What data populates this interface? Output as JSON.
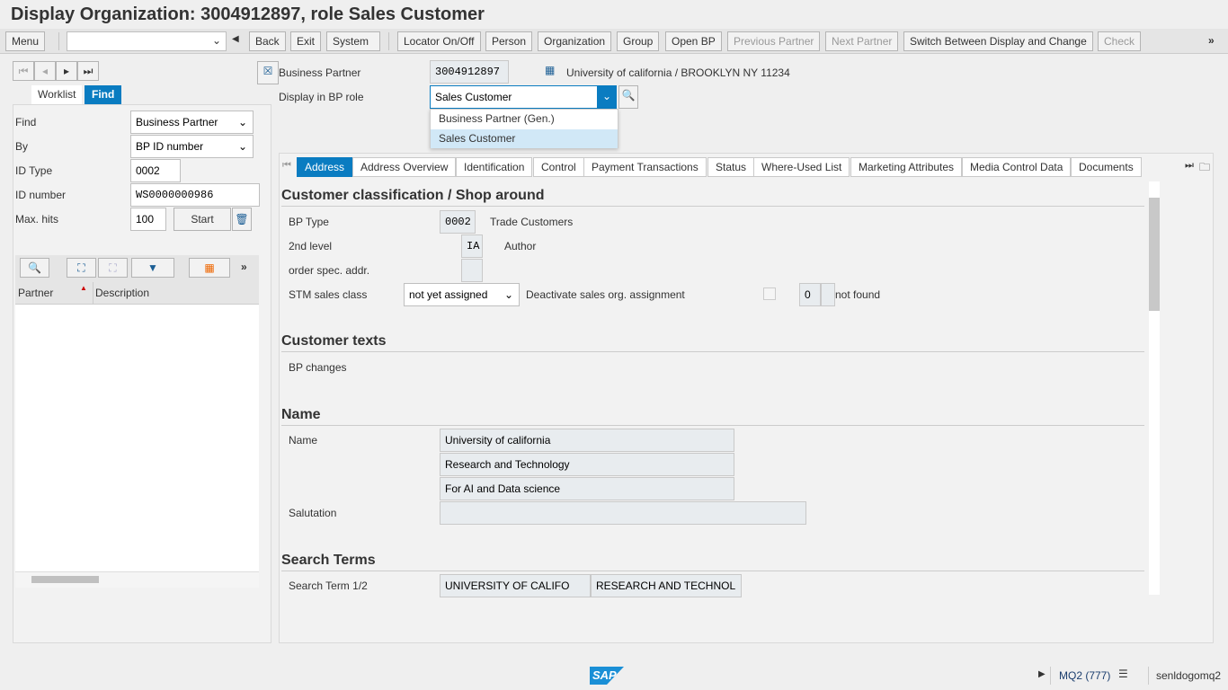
{
  "title": "Display Organization: 3004912897, role Sales Customer",
  "toolbar": {
    "menu": "Menu",
    "back": "Back",
    "exit": "Exit",
    "system": "System",
    "locator": "Locator On/Off",
    "person": "Person",
    "organization": "Organization",
    "group": "Group",
    "open_bp": "Open BP",
    "prev_partner": "Previous Partner",
    "next_partner": "Next Partner",
    "switch": "Switch Between Display and Change",
    "check": "Check",
    "command_value": ""
  },
  "left": {
    "tabs": [
      "Worklist",
      "Find"
    ],
    "active_tab": "Find",
    "find_label": "Find",
    "find_value": "Business Partner",
    "by_label": "By",
    "by_value": "BP ID number",
    "idtype_label": "ID Type",
    "idtype_value": "0002",
    "idnum_label": "ID number",
    "idnum_value": "WS0000000986",
    "maxhits_label": "Max. hits",
    "maxhits_value": "100",
    "start": "Start",
    "columns": [
      "Partner",
      "Description"
    ]
  },
  "header": {
    "bp_label": "Business Partner",
    "bp_value": "3004912897",
    "bp_desc": "University of california / BROOKLYN NY 11234",
    "role_label": "Display in BP role",
    "role_value": "Sales Customer",
    "role_options": [
      "Business Partner (Gen.)",
      "Sales Customer"
    ]
  },
  "tabs": [
    "Address",
    "Address Overview",
    "Identification",
    "Control",
    "Payment Transactions",
    "Status",
    "Where-Used List",
    "Marketing Attributes",
    "Media Control Data",
    "Documents"
  ],
  "active_tab": "Address",
  "classification": {
    "title": "Customer classification / Shop around",
    "bp_type_label": "BP Type",
    "bp_type_value": "0002",
    "bp_type_desc": "Trade Customers",
    "level2_label": "2nd level",
    "level2_value": "IA",
    "level2_desc": "Author",
    "order_label": "order spec. addr.",
    "stm_label": "STM sales class",
    "stm_value": "not yet assigned",
    "deact_label": "Deactivate sales org. assignment",
    "deact_num": "0",
    "deact_status": "not found"
  },
  "texts": {
    "title": "Customer texts",
    "bp_changes": "BP changes"
  },
  "name": {
    "title": "Name",
    "label": "Name",
    "line1": "University of california",
    "line2": "Research and Technology",
    "line3": "For AI and Data science",
    "salutation_label": "Salutation",
    "salutation_value": ""
  },
  "search": {
    "title": "Search Terms",
    "label": "Search Term 1/2",
    "term1": "UNIVERSITY OF CALIFO",
    "term2": "RESEARCH AND TECHNOL"
  },
  "status": {
    "system": "MQ2 (777)",
    "user": "senldogomq2",
    "logo": "SAP"
  },
  "colors": {
    "accent": "#0a7cc1",
    "logo": "#1a8fd6"
  }
}
